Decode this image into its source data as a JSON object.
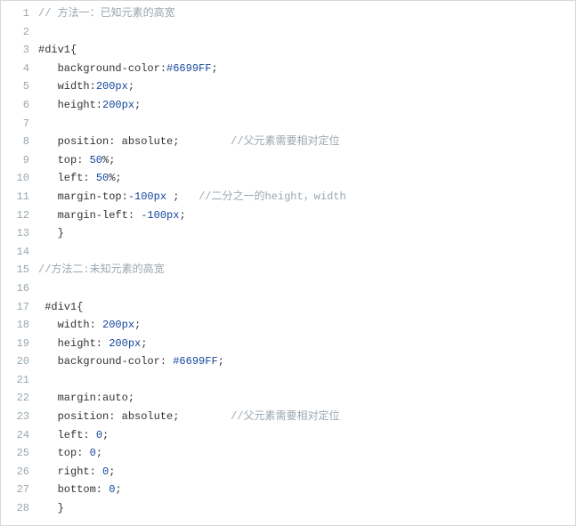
{
  "code": {
    "lines": [
      {
        "n": "1",
        "segments": [
          {
            "cls": "comment",
            "text": "// 方法一：已知元素的高宽"
          }
        ]
      },
      {
        "n": "2",
        "segments": [
          {
            "cls": "code-text",
            "text": ""
          }
        ]
      },
      {
        "n": "3",
        "segments": [
          {
            "cls": "code-text",
            "text": "#div1{"
          }
        ]
      },
      {
        "n": "4",
        "segments": [
          {
            "cls": "code-text",
            "text": "   background-color:"
          },
          {
            "cls": "lit",
            "text": "#6699FF"
          },
          {
            "cls": "code-text",
            "text": ";"
          }
        ]
      },
      {
        "n": "5",
        "segments": [
          {
            "cls": "code-text",
            "text": "   width:"
          },
          {
            "cls": "lit",
            "text": "200px"
          },
          {
            "cls": "code-text",
            "text": ";"
          }
        ]
      },
      {
        "n": "6",
        "segments": [
          {
            "cls": "code-text",
            "text": "   height:"
          },
          {
            "cls": "lit",
            "text": "200px"
          },
          {
            "cls": "code-text",
            "text": ";"
          }
        ]
      },
      {
        "n": "7",
        "segments": [
          {
            "cls": "code-text",
            "text": ""
          }
        ]
      },
      {
        "n": "8",
        "segments": [
          {
            "cls": "code-text",
            "text": "   position: absolute;        "
          },
          {
            "cls": "comment",
            "text": "//父元素需要相对定位"
          }
        ]
      },
      {
        "n": "9",
        "segments": [
          {
            "cls": "code-text",
            "text": "   top: "
          },
          {
            "cls": "lit",
            "text": "50"
          },
          {
            "cls": "code-text",
            "text": "%;"
          }
        ]
      },
      {
        "n": "10",
        "segments": [
          {
            "cls": "code-text",
            "text": "   left: "
          },
          {
            "cls": "lit",
            "text": "50"
          },
          {
            "cls": "code-text",
            "text": "%;"
          }
        ]
      },
      {
        "n": "11",
        "segments": [
          {
            "cls": "code-text",
            "text": "   margin-top:"
          },
          {
            "cls": "lit",
            "text": "-100px"
          },
          {
            "cls": "code-text",
            "text": " ;   "
          },
          {
            "cls": "comment",
            "text": "//二分之一的height，width"
          }
        ]
      },
      {
        "n": "12",
        "segments": [
          {
            "cls": "code-text",
            "text": "   margin-left: "
          },
          {
            "cls": "lit",
            "text": "-100px"
          },
          {
            "cls": "code-text",
            "text": ";"
          }
        ]
      },
      {
        "n": "13",
        "segments": [
          {
            "cls": "code-text",
            "text": "   }"
          }
        ]
      },
      {
        "n": "14",
        "segments": [
          {
            "cls": "code-text",
            "text": ""
          }
        ]
      },
      {
        "n": "15",
        "segments": [
          {
            "cls": "comment",
            "text": "//方法二:未知元素的高宽"
          }
        ]
      },
      {
        "n": "16",
        "segments": [
          {
            "cls": "code-text",
            "text": ""
          }
        ]
      },
      {
        "n": "17",
        "segments": [
          {
            "cls": "code-text",
            "text": " #div1{"
          }
        ]
      },
      {
        "n": "18",
        "segments": [
          {
            "cls": "code-text",
            "text": "   width: "
          },
          {
            "cls": "lit",
            "text": "200px"
          },
          {
            "cls": "code-text",
            "text": ";"
          }
        ]
      },
      {
        "n": "19",
        "segments": [
          {
            "cls": "code-text",
            "text": "   height: "
          },
          {
            "cls": "lit",
            "text": "200px"
          },
          {
            "cls": "code-text",
            "text": ";"
          }
        ]
      },
      {
        "n": "20",
        "segments": [
          {
            "cls": "code-text",
            "text": "   background-color: "
          },
          {
            "cls": "lit",
            "text": "#6699FF"
          },
          {
            "cls": "code-text",
            "text": ";"
          }
        ]
      },
      {
        "n": "21",
        "segments": [
          {
            "cls": "code-text",
            "text": ""
          }
        ]
      },
      {
        "n": "22",
        "segments": [
          {
            "cls": "code-text",
            "text": "   margin:auto;"
          }
        ]
      },
      {
        "n": "23",
        "segments": [
          {
            "cls": "code-text",
            "text": "   position: absolute;        "
          },
          {
            "cls": "comment",
            "text": "//父元素需要相对定位"
          }
        ]
      },
      {
        "n": "24",
        "segments": [
          {
            "cls": "code-text",
            "text": "   left: "
          },
          {
            "cls": "lit",
            "text": "0"
          },
          {
            "cls": "code-text",
            "text": ";"
          }
        ]
      },
      {
        "n": "25",
        "segments": [
          {
            "cls": "code-text",
            "text": "   top: "
          },
          {
            "cls": "lit",
            "text": "0"
          },
          {
            "cls": "code-text",
            "text": ";"
          }
        ]
      },
      {
        "n": "26",
        "segments": [
          {
            "cls": "code-text",
            "text": "   right: "
          },
          {
            "cls": "lit",
            "text": "0"
          },
          {
            "cls": "code-text",
            "text": ";"
          }
        ]
      },
      {
        "n": "27",
        "segments": [
          {
            "cls": "code-text",
            "text": "   bottom: "
          },
          {
            "cls": "lit",
            "text": "0"
          },
          {
            "cls": "code-text",
            "text": ";"
          }
        ]
      },
      {
        "n": "28",
        "segments": [
          {
            "cls": "code-text",
            "text": "   }"
          }
        ]
      }
    ]
  }
}
